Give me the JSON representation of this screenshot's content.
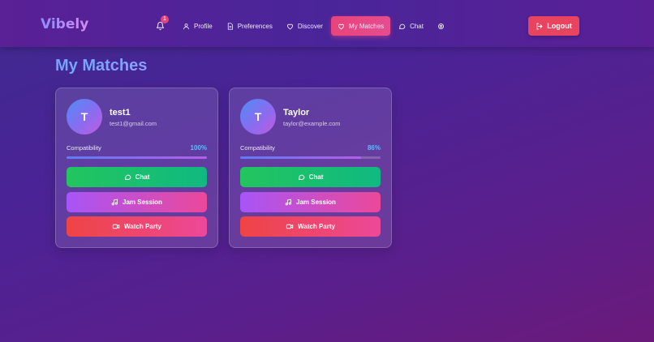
{
  "app": {
    "logo": "Vibely"
  },
  "nav": {
    "notification_count": "1",
    "items": [
      {
        "label": "Profile",
        "icon": "user-icon"
      },
      {
        "label": "Preferences",
        "icon": "preferences-icon"
      },
      {
        "label": "Discover",
        "icon": "heart-icon"
      },
      {
        "label": "My Matches",
        "icon": "heart-icon",
        "active": true
      },
      {
        "label": "Chat",
        "icon": "chat-bubble-icon"
      }
    ],
    "logout_label": "Logout"
  },
  "page": {
    "title": "My Matches"
  },
  "matches": [
    {
      "initial": "T",
      "name": "test1",
      "email": "test1@gmail.com",
      "compatibility_label": "Compatibility",
      "compatibility_value": "100%",
      "compatibility_fraction": 1.0,
      "buttons": {
        "chat": "Chat",
        "jam": "Jam Session",
        "watch": "Watch Party"
      }
    },
    {
      "initial": "T",
      "name": "Taylor",
      "email": "taylor@example.com",
      "compatibility_label": "Compatibility",
      "compatibility_value": "86%",
      "compatibility_fraction": 0.86,
      "buttons": {
        "chat": "Chat",
        "jam": "Jam Session",
        "watch": "Watch Party"
      }
    }
  ],
  "colors": {
    "accent": "#e8437c",
    "logout": "#e8435f",
    "chat_button": "#22c55e",
    "jam_button": "#a855f7",
    "watch_button": "#ef4444",
    "compatibility_text": "#6cb4ff"
  }
}
